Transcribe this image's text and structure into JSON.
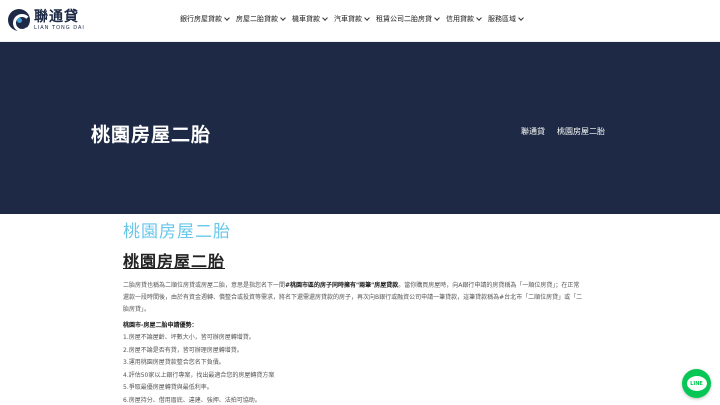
{
  "header": {
    "logo_cn": "聯通貸",
    "logo_en": "LIAN TONG DAI",
    "nav": [
      "銀行房屋貸款",
      "房屋二胎貸款",
      "機車貸款",
      "汽車貸款",
      "租賃公司二胎房貸",
      "信用貸款",
      "服務區域"
    ]
  },
  "hero": {
    "title": "桃園房屋二胎",
    "breadcrumb": [
      "聯通貸",
      "桃園房屋二胎"
    ]
  },
  "content": {
    "heading_light": "桃園房屋二胎",
    "heading_dark": "桃園房屋二胎",
    "paragraph_pre": "二胎房貸也稱為二順位房貸或房屋二胎，意思是指您名下一間",
    "paragraph_bold": "#桃園市區的房子同時擁有\"兩筆\"房屋貸款",
    "paragraph_post": "。當你購買房屋時，向A銀行申請的房貸稱為「一順位房貸」；在正常還款一段時間後，由於有資金週轉、償整合或投資等需求，將名下還需還房貸款的房子，再次向B銀行或融資公司申請一筆貸款，這筆貸款稱為#台北市「二順位房貸」或「二胎房貸」。",
    "sub_heading": "桃園市-房屋二胎申請優勢：",
    "advantages": [
      "1.房屋不論屋齡、坪數大小，皆可辦房屋轉增貸。",
      "2.房屋不論是否有貸，皆可辦理房屋轉增貸。",
      "3.運用桃園房屋貸款整合您名下負債。",
      "4.評估50家以上銀行專案，找出最適合您的房屋轉貸方案",
      "5.爭取最優房屋轉貸與最低利率。",
      "6.房屋持分、借用厝底、違建、強押、法拍可協助。"
    ]
  },
  "line_button": {
    "label": "LINE",
    "color": "#06c755"
  },
  "colors": {
    "hero_bg": "#1e2a45",
    "accent_light": "#69c7ea"
  }
}
